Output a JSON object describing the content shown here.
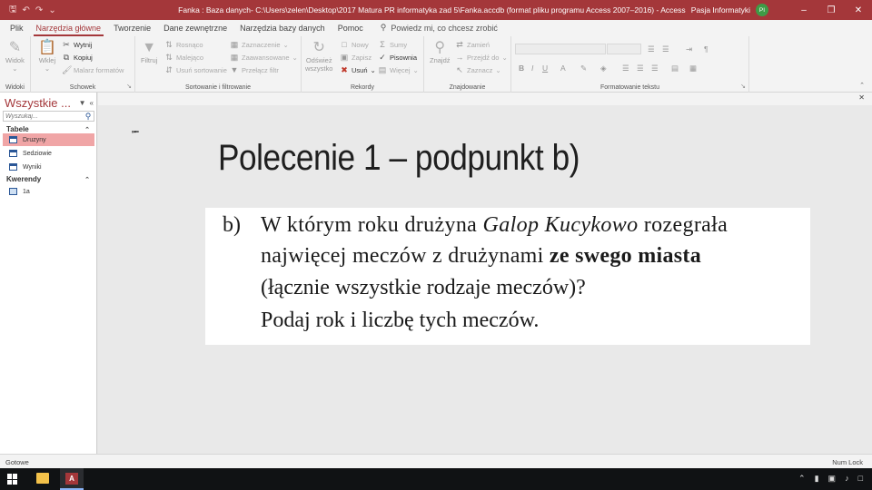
{
  "window": {
    "title": "Fanka : Baza danych- C:\\Users\\zelen\\Desktop\\2017 Matura PR informatyka zad 5\\Fanka.accdb (format pliku programu Access 2007–2016) - Access",
    "user_name": "Pasja Informatyki",
    "user_initials": "PI"
  },
  "tabs": [
    {
      "label": "Plik"
    },
    {
      "label": "Narzędzia główne"
    },
    {
      "label": "Tworzenie"
    },
    {
      "label": "Dane zewnętrzne"
    },
    {
      "label": "Narzędzia bazy danych"
    },
    {
      "label": "Pomoc"
    }
  ],
  "tell_me": "Powiedz mi, co chcesz zrobić",
  "ribbon": {
    "widoki": {
      "label": "Widoki",
      "widok": "Widok"
    },
    "schowek": {
      "label": "Schowek",
      "wklej": "Wklej",
      "wytnij": "Wytnij",
      "kopiuj": "Kopiuj",
      "malarz": "Malarz formatów"
    },
    "sortowanie": {
      "label": "Sortowanie i filtrowanie",
      "filtruj": "Filtruj",
      "rosnaco": "Rosnąco",
      "malejaco": "Malejąco",
      "usun_sort": "Usuń sortowanie",
      "zaznaczenie": "Zaznaczenie",
      "zaawansowane": "Zaawansowane",
      "przelacz": "Przełącz filtr"
    },
    "rekordy": {
      "label": "Rekordy",
      "odswiez1": "Odśwież",
      "odswiez2": "wszystko",
      "nowy": "Nowy",
      "zapisz": "Zapisz",
      "usun": "Usuń",
      "sumy": "Sumy",
      "pisownia": "Pisownia",
      "wiecej": "Więcej"
    },
    "znajdowanie": {
      "label": "Znajdowanie",
      "znajdz": "Znajdź",
      "zamien": "Zamień",
      "przejdz": "Przejdź do",
      "zaznacz": "Zaznacz"
    },
    "formatowanie": {
      "label": "Formatowanie tekstu"
    }
  },
  "nav": {
    "title": "Wszystkie ...",
    "search_placeholder": "Wyszukaj...",
    "sections": [
      {
        "label": "Tabele",
        "items": [
          {
            "label": "Druzyny",
            "selected": true
          },
          {
            "label": "Sedziowie"
          },
          {
            "label": "Wyniki"
          }
        ]
      },
      {
        "label": "Kwerendy",
        "items": [
          {
            "label": "1a"
          }
        ]
      }
    ]
  },
  "slide": {
    "title": "Polecenie 1 – podpunkt b)",
    "marker": "b)",
    "line1_pre": "W którym roku drużyna ",
    "line1_italic": "Galop Kucykowo",
    "line1_post": " rozegrała",
    "line2_pre": "najwięcej meczów z drużynami ",
    "line2_bold": "ze swego miasta",
    "line3": "(łącznie wszystkie rodzaje meczów)?",
    "line4": "Podaj rok i liczbę tych meczów."
  },
  "status": {
    "left": "Gotowe",
    "right": "Num Lock"
  }
}
